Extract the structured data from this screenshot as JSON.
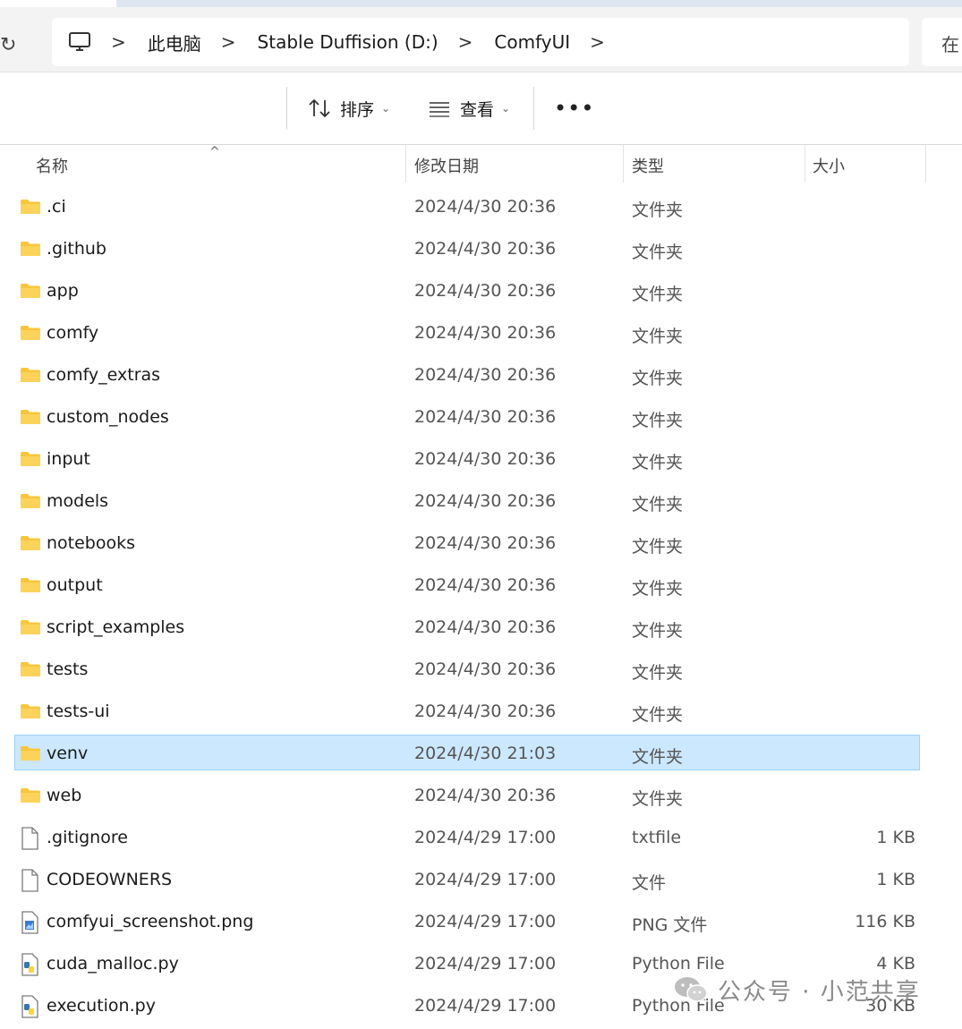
{
  "breadcrumb": [
    "此电脑",
    "Stable Duffision (D:)",
    "ComfyUI"
  ],
  "search": {
    "label": "在"
  },
  "toolbar": {
    "sort_label": "排序",
    "view_label": "查看",
    "more_label": "•••"
  },
  "columns": {
    "name": "名称",
    "date": "修改日期",
    "type": "类型",
    "size": "大小"
  },
  "files": [
    {
      "name": ".ci",
      "date": "2024/4/30 20:36",
      "type": "文件夹",
      "size": "",
      "icon": "folder-icon"
    },
    {
      "name": ".github",
      "date": "2024/4/30 20:36",
      "type": "文件夹",
      "size": "",
      "icon": "folder-icon"
    },
    {
      "name": "app",
      "date": "2024/4/30 20:36",
      "type": "文件夹",
      "size": "",
      "icon": "folder-icon"
    },
    {
      "name": "comfy",
      "date": "2024/4/30 20:36",
      "type": "文件夹",
      "size": "",
      "icon": "folder-icon"
    },
    {
      "name": "comfy_extras",
      "date": "2024/4/30 20:36",
      "type": "文件夹",
      "size": "",
      "icon": "folder-icon"
    },
    {
      "name": "custom_nodes",
      "date": "2024/4/30 20:36",
      "type": "文件夹",
      "size": "",
      "icon": "folder-icon"
    },
    {
      "name": "input",
      "date": "2024/4/30 20:36",
      "type": "文件夹",
      "size": "",
      "icon": "folder-icon"
    },
    {
      "name": "models",
      "date": "2024/4/30 20:36",
      "type": "文件夹",
      "size": "",
      "icon": "folder-icon"
    },
    {
      "name": "notebooks",
      "date": "2024/4/30 20:36",
      "type": "文件夹",
      "size": "",
      "icon": "folder-icon"
    },
    {
      "name": "output",
      "date": "2024/4/30 20:36",
      "type": "文件夹",
      "size": "",
      "icon": "folder-icon"
    },
    {
      "name": "script_examples",
      "date": "2024/4/30 20:36",
      "type": "文件夹",
      "size": "",
      "icon": "folder-icon"
    },
    {
      "name": "tests",
      "date": "2024/4/30 20:36",
      "type": "文件夹",
      "size": "",
      "icon": "folder-icon"
    },
    {
      "name": "tests-ui",
      "date": "2024/4/30 20:36",
      "type": "文件夹",
      "size": "",
      "icon": "folder-icon"
    },
    {
      "name": "venv",
      "date": "2024/4/30 21:03",
      "type": "文件夹",
      "size": "",
      "icon": "folder-icon",
      "selected": true
    },
    {
      "name": "web",
      "date": "2024/4/30 20:36",
      "type": "文件夹",
      "size": "",
      "icon": "folder-icon"
    },
    {
      "name": ".gitignore",
      "date": "2024/4/29 17:00",
      "type": "txtfile",
      "size": "1 KB",
      "icon": "file-icon"
    },
    {
      "name": "CODEOWNERS",
      "date": "2024/4/29 17:00",
      "type": "文件",
      "size": "1 KB",
      "icon": "file-icon"
    },
    {
      "name": "comfyui_screenshot.png",
      "date": "2024/4/29 17:00",
      "type": "PNG 文件",
      "size": "116 KB",
      "icon": "image-file-icon"
    },
    {
      "name": "cuda_malloc.py",
      "date": "2024/4/29 17:00",
      "type": "Python File",
      "size": "4 KB",
      "icon": "python-file-icon"
    },
    {
      "name": "execution.py",
      "date": "2024/4/29 17:00",
      "type": "Python File",
      "size": "30 KB",
      "icon": "python-file-icon"
    }
  ],
  "watermark": {
    "text": "公众号 · 小范共享"
  },
  "colors": {
    "selection_bg": "#cce8ff",
    "selection_border": "#99d1ff",
    "folder": "#f8c63d"
  }
}
